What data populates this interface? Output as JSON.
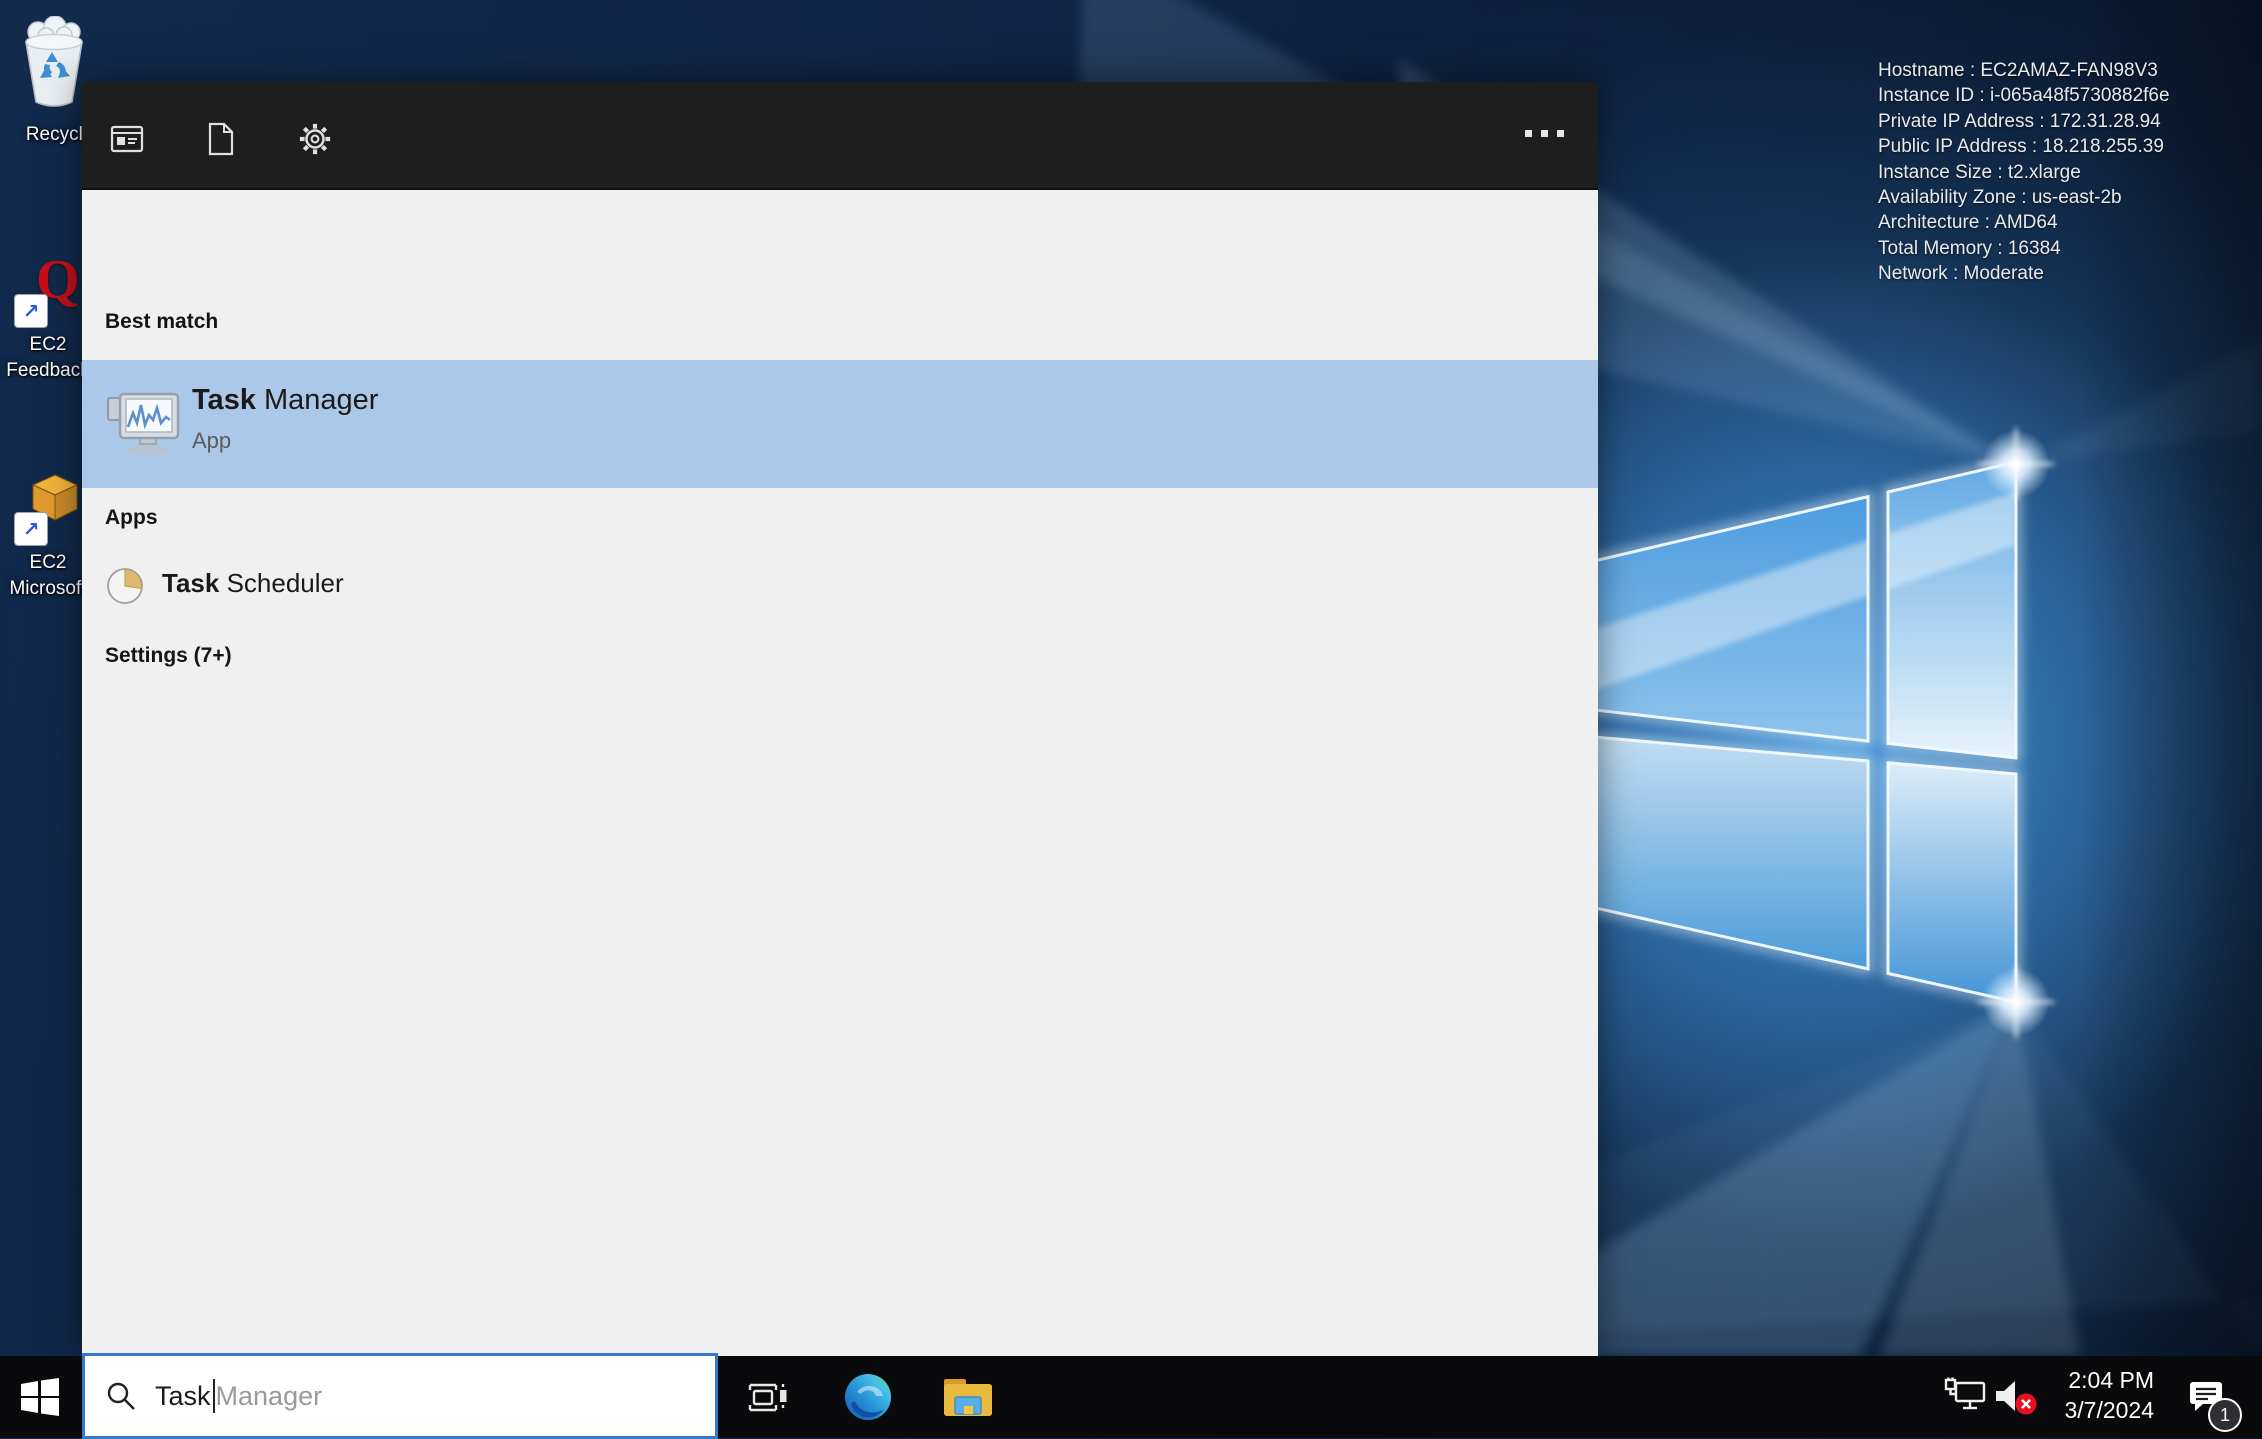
{
  "colors": {
    "accent_blue": "#0078d7",
    "selection_blue": "#abc8e8",
    "panel_header": "#1e1e1e",
    "panel_body": "#f0f0f0",
    "taskbar": "#0a0a0c",
    "mute_red": "#e81123"
  },
  "desktop": {
    "icons": [
      {
        "name": "recycle-bin",
        "label": "Recycle Bin"
      },
      {
        "name": "ec2-feedback",
        "line1": "EC2",
        "line2": "Feedback"
      },
      {
        "name": "ec2-microsoft",
        "line1": "EC2",
        "line2": "Microsoft"
      }
    ]
  },
  "ec2_info": {
    "lines": [
      "Hostname : EC2AMAZ-FAN98V3",
      "Instance ID : i-065a48f5730882f6e",
      "Private IP Address : 172.31.28.94",
      "Public IP Address : 18.218.255.39",
      "Instance Size : t2.xlarge",
      "Availability Zone : us-east-2b",
      "Architecture : AMD64",
      "Total Memory : 16384",
      "Network : Moderate"
    ]
  },
  "panel": {
    "filters": [
      "apps",
      "documents",
      "settings",
      "more"
    ],
    "sections": {
      "best_match": {
        "header": "Best match",
        "item": {
          "title_bold": "Task",
          "title_rest": " Manager",
          "subtitle": "App"
        }
      },
      "apps": {
        "header": "Apps",
        "item": {
          "title_bold": "Task",
          "title_rest": " Scheduler"
        }
      },
      "settings": {
        "header": "Settings (7+)"
      }
    }
  },
  "taskbar": {
    "buttons": [
      "start",
      "task-view",
      "edge",
      "file-explorer"
    ],
    "search": {
      "typed": "Task",
      "suggestion": "Manager"
    },
    "tray": {
      "icons": [
        "network",
        "volume-muted",
        "action-center"
      ],
      "time": "2:04 PM",
      "date": "3/7/2024",
      "badge": "1"
    }
  }
}
